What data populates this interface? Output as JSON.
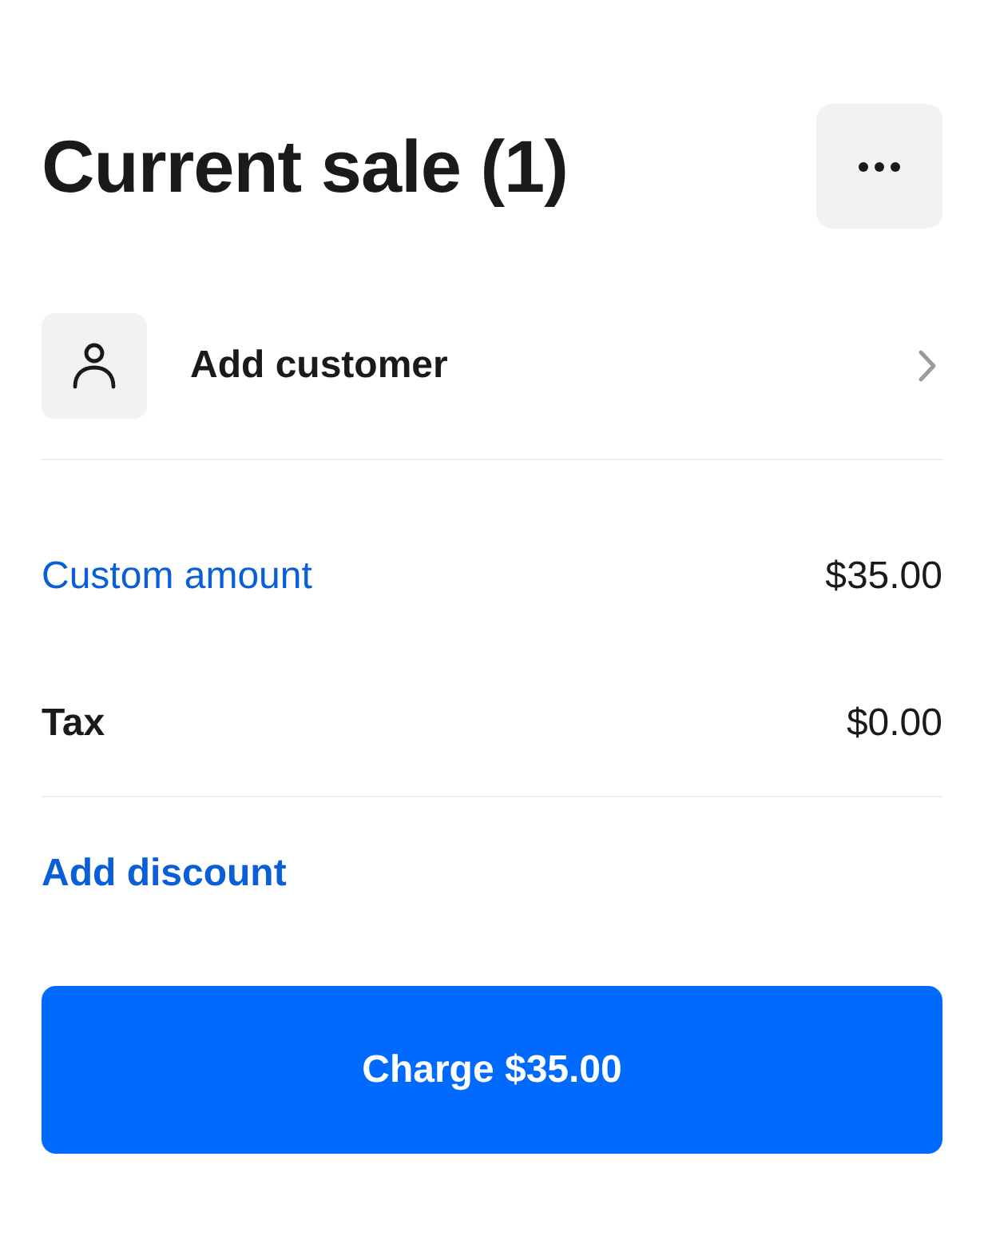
{
  "header": {
    "title": "Current sale (1)"
  },
  "customer": {
    "label": "Add customer"
  },
  "line_items": [
    {
      "kind": "link",
      "label": "Custom amount",
      "amount": "$35.00"
    },
    {
      "kind": "plain",
      "label": "Tax",
      "amount": "$0.00"
    }
  ],
  "discount": {
    "label": "Add discount"
  },
  "charge_button": {
    "label": "Charge $35.00"
  }
}
